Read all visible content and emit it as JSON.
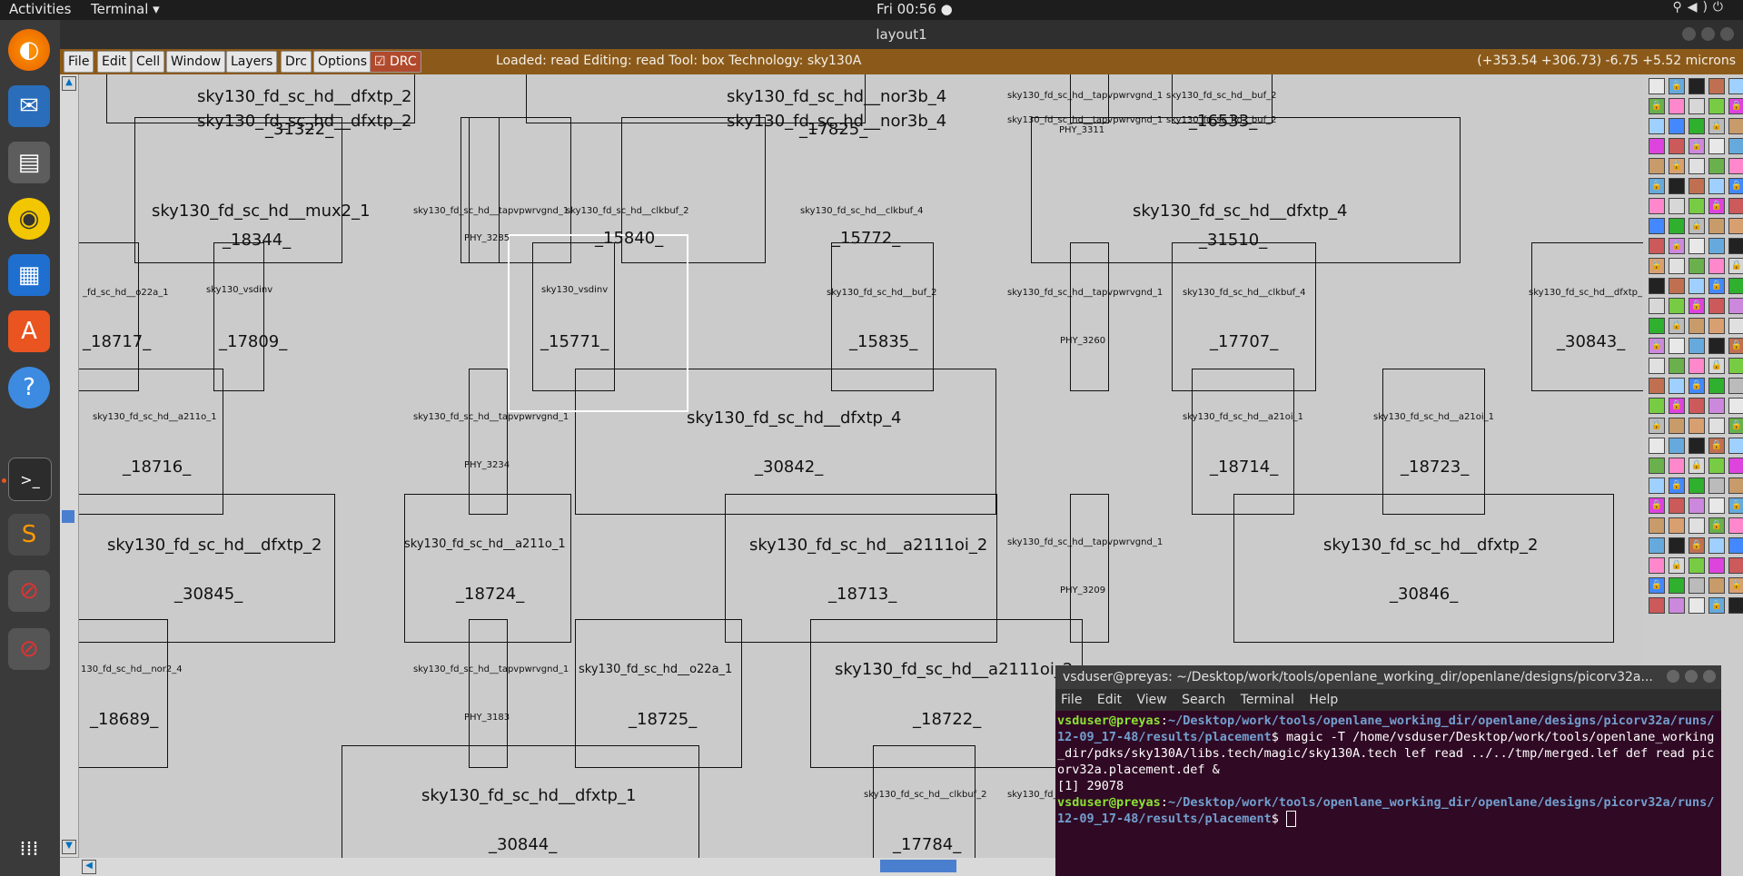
{
  "topbar": {
    "activities": "Activities",
    "app": "Terminal ▾",
    "clock": "Fri 00:56 ●"
  },
  "dock": {
    "items": [
      "firefox-icon",
      "thunderbird-icon",
      "files-icon",
      "rhythmbox-icon",
      "writer-icon",
      "software-icon",
      "help-icon",
      "terminal-icon",
      "sublime-icon",
      "blocked-app-icon",
      "blocked-app-icon-2",
      "show-apps-icon"
    ]
  },
  "window": {
    "title": "layout1"
  },
  "menubar": {
    "file": "File",
    "edit": "Edit",
    "cell": "Cell",
    "window": "Window",
    "layers": "Layers",
    "drc": "Drc",
    "options": "Options",
    "drc_toggle": "DRC",
    "status": "Loaded: read Editing: read Tool: box  Technology: sky130A",
    "coords": "(+353.54 +306.73) -6.75 +5.52 microns"
  },
  "labels": {
    "l1": "sky130_fd_sc_hd__dfxtp_2",
    "l2": "sky130_fd_sc_hd__dfxtp_2",
    "l2b": "_31322_",
    "l3": "sky130_fd_sc_hd__nor3b_4",
    "l4": "sky130_fd_sc_hd__nor3b_4",
    "l4b": "_17825_",
    "l5": "sky130_fd_sc_hd__tapvpwrvgnd_1",
    "l6": "sky130_fd_sc_hd__buf_2",
    "l7": "sky130_fd_sc_hd__tapvpwrvgnd_1",
    "l7b": "PHY_3311",
    "l8": "sky130_fd_sc_hd__buf_2",
    "l8b": "_16533_",
    "m1": "sky130_fd_sc_hd__mux2_1",
    "m1b": "_18344_",
    "t1": "sky130_fd_sc_hd__tapvpwrvgnd_1",
    "t1b": "PHY_3285",
    "c1": "sky130_fd_sc_hd__clkbuf_2",
    "c1b": "_15840_",
    "c2": "sky130_fd_sc_hd__clkbuf_4",
    "c2b": "_15772_",
    "d4": "sky130_fd_sc_hd__dfxtp_4",
    "d4b": "_31510_",
    "o1": "_fd_sc_hd__o22a_1",
    "o1b": "_18717_",
    "v1": "sky130_vsdinv",
    "v1b": "_17809_",
    "v2": "sky130_vsdinv",
    "v2b": "_15771_",
    "b2": "sky130_fd_sc_hd__buf_2",
    "b2b": "_15835_",
    "t2": "sky130_fd_sc_hd__tapvpwrvgnd_1",
    "t2b": "PHY_3260",
    "c4": "sky130_fd_sc_hd__clkbuf_4",
    "c4b": "_17707_",
    "df": "sky130_fd_sc_hd__dfxtp_",
    "dfb": "_30843_",
    "a1": "sky130_fd_sc_hd__a211o_1",
    "a1b": "_18716_",
    "t3": "sky130_fd_sc_hd__tapvpwrvgnd_1",
    "t3b": "PHY_3234",
    "d42": "sky130_fd_sc_hd__dfxtp_4",
    "d42b": "_30842_",
    "a2": "sky130_fd_sc_hd__a21oi_1",
    "a2b": "_18714_",
    "a3": "sky130_fd_sc_hd__a21oi_1",
    "a3b": "_18723_",
    "d2": "sky130_fd_sc_hd__dfxtp_2",
    "d2b": "_30845_",
    "a4": "sky130_fd_sc_hd__a211o_1",
    "a4b": "_18724_",
    "a5": "sky130_fd_sc_hd__a2111oi_2",
    "a5b": "_18713_",
    "t4": "sky130_fd_sc_hd__tapvpwrvgnd_1",
    "t4b": "PHY_3209",
    "d22": "sky130_fd_sc_hd__dfxtp_2",
    "d22b": "_30846_",
    "n1": "130_fd_sc_hd__nor2_4",
    "n1b": "_18689_",
    "t5": "sky130_fd_sc_hd__tapvpwrvgnd_1",
    "t5b": "PHY_3183",
    "o2": "sky130_fd_sc_hd__o22a_1",
    "o2b": "_18725_",
    "a6": "sky130_fd_sc_hd__a2111oi_2",
    "a6b": "_18722_",
    "d1": "sky130_fd_sc_hd__dfxtp_1",
    "d1b": "_30844_",
    "c3": "sky130_fd_sc_hd__clkbuf_2",
    "c3b": "_17784_",
    "t6": "sky130_fd_"
  },
  "terminal": {
    "title": "vsduser@preyas: ~/Desktop/work/tools/openlane_working_dir/openlane/designs/picorv32a...",
    "menu": [
      "File",
      "Edit",
      "View",
      "Search",
      "Terminal",
      "Help"
    ],
    "user": "vsduser@preyas",
    "path": "~/Desktop/work/tools/openlane_working_dir/openlane/designs/picorv32a/runs/12-09_17-48/results/placement",
    "cmd": "$ magic -T /home/vsduser/Desktop/work/tools/openlane_working_dir/pdks/sky130A/libs.tech/magic/sky130A.tech lef read ../../tmp/merged.lef def read picorv32a.placement.def &",
    "job": "[1] 29078",
    "prompt_end": "$ "
  }
}
